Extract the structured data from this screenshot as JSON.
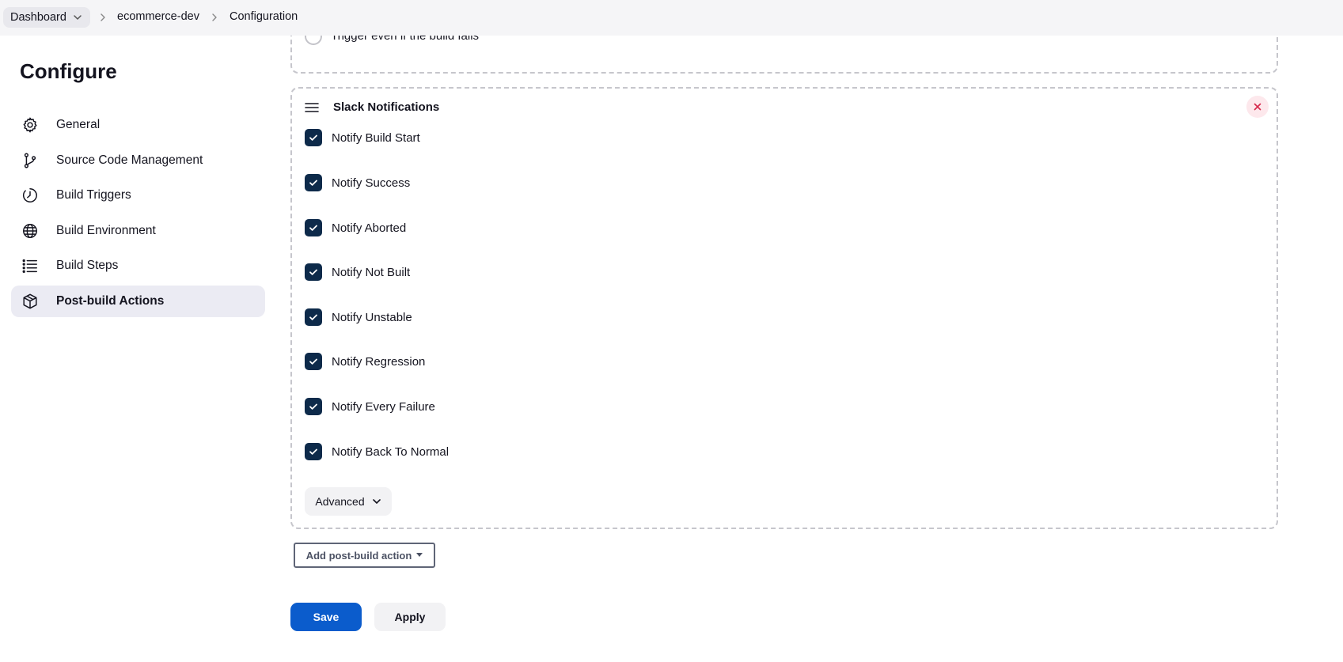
{
  "breadcrumb": {
    "items": [
      "Dashboard",
      "ecommerce-dev",
      "Configuration"
    ]
  },
  "sidebar": {
    "title": "Configure",
    "items": [
      {
        "label": "General",
        "icon": "gear-icon",
        "active": false
      },
      {
        "label": "Source Code Management",
        "icon": "branch-icon",
        "active": false
      },
      {
        "label": "Build Triggers",
        "icon": "timer-icon",
        "active": false
      },
      {
        "label": "Build Environment",
        "icon": "globe-icon",
        "active": false
      },
      {
        "label": "Build Steps",
        "icon": "list-icon",
        "active": false
      },
      {
        "label": "Post-build Actions",
        "icon": "package-icon",
        "active": true
      }
    ]
  },
  "previous_section": {
    "radio_label": "Trigger even if the build fails",
    "radio_checked": false
  },
  "slack": {
    "title": "Slack Notifications",
    "options": [
      {
        "label": "Notify Build Start",
        "checked": true
      },
      {
        "label": "Notify Success",
        "checked": true
      },
      {
        "label": "Notify Aborted",
        "checked": true
      },
      {
        "label": "Notify Not Built",
        "checked": true
      },
      {
        "label": "Notify Unstable",
        "checked": true
      },
      {
        "label": "Notify Regression",
        "checked": true
      },
      {
        "label": "Notify Every Failure",
        "checked": true
      },
      {
        "label": "Notify Back To Normal",
        "checked": true
      }
    ],
    "advanced_label": "Advanced"
  },
  "add_action_label": "Add post-build action",
  "buttons": {
    "save": "Save",
    "apply": "Apply"
  },
  "colors": {
    "primary": "#0b5ccc",
    "checkbox": "#0d2a4a",
    "active_nav_bg": "#ebebf3",
    "close_bg": "#fde8ec",
    "close_icon": "#d6284b"
  }
}
